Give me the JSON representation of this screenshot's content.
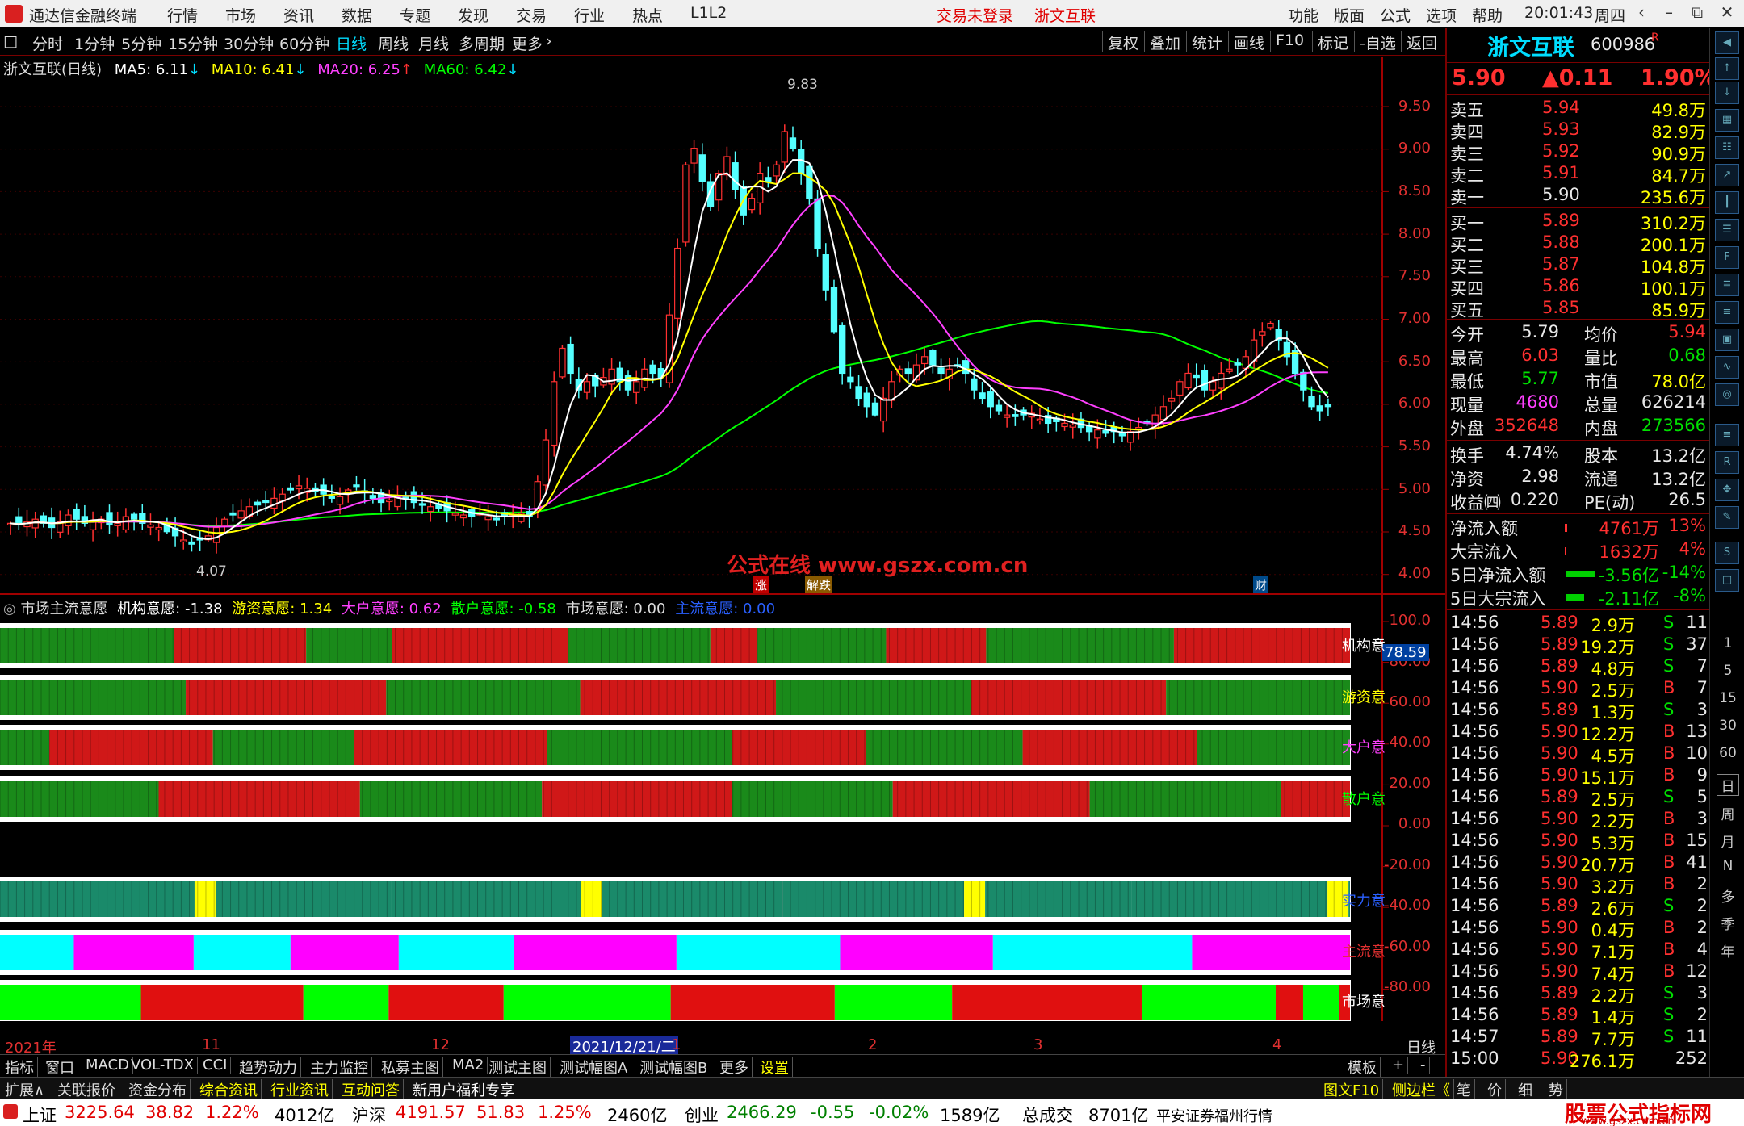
{
  "titlebar": {
    "app": "通达信金融终端",
    "menus": [
      "行情",
      "市场",
      "资讯",
      "数据",
      "专题",
      "发现",
      "交易",
      "行业",
      "热点",
      "L1L2"
    ],
    "login": "交易未登录",
    "stock": "浙文互联",
    "rmenus": [
      "功能",
      "版面",
      "公式",
      "选项",
      "帮助"
    ],
    "time": "20:01:43",
    "weekday": "周四"
  },
  "toolbar": {
    "periods": [
      "分时",
      "1分钟",
      "5分钟",
      "15分钟",
      "30分钟",
      "60分钟",
      "日线",
      "周线",
      "月线",
      "多周期",
      "更多"
    ],
    "active": "日线",
    "right": [
      "复权",
      "叠加",
      "统计",
      "画线",
      "F10",
      "标记",
      "-自选",
      "返回"
    ]
  },
  "legend": {
    "name": "浙文互联(日线)",
    "ma5": "MA5: 6.11",
    "ma10": "MA10: 6.41",
    "ma20": "MA20: 6.25",
    "ma60": "MA60: 6.42",
    "high": "9.83",
    "low": "4.07"
  },
  "price_axis": [
    "9.50",
    "9.00",
    "8.50",
    "8.00",
    "7.50",
    "7.00",
    "6.50",
    "6.00",
    "5.50",
    "5.00",
    "4.50",
    "4.00"
  ],
  "events": {
    "zhang": "涨",
    "jiedie": "解跌",
    "cai": "财"
  },
  "indicator": {
    "name": "市场主流意愿",
    "jg": "机构意愿: -1.38",
    "yz": "游资意愿: 1.34",
    "dh": "大户意愿: 0.62",
    "sh": "散户意愿: -0.58",
    "sc": "市场意愿: 0.00",
    "zl": "主流意愿: 0.00",
    "cur": "78.59",
    "labels": [
      "机构意",
      "游资意",
      "大户意",
      "散户意",
      "实力意",
      "主流意",
      "市场意"
    ]
  },
  "ind_axis": [
    "100.0",
    "80.00",
    "60.00",
    "40.00",
    "20.00",
    "0.00",
    "-20.00",
    "-40.00",
    "-60.00",
    "-80.00"
  ],
  "date_axis": {
    "y2021": "2021年",
    "m11": "11",
    "m12": "12",
    "cursor": "2021/12/21/二",
    "m1": "1",
    "m2": "2",
    "m3": "3",
    "m4": "4",
    "period": "日线"
  },
  "watermark": {
    "text": "公式在线  www.gszx.com.cn"
  },
  "quote": {
    "name": "浙文互联",
    "code": "600986",
    "flag": "R",
    "price": "5.90",
    "change": "▲0.11",
    "pct": "1.90%",
    "sells": [
      [
        "卖五",
        "5.94",
        "49.8万"
      ],
      [
        "卖四",
        "5.93",
        "82.9万"
      ],
      [
        "卖三",
        "5.92",
        "90.9万"
      ],
      [
        "卖二",
        "5.91",
        "84.7万"
      ],
      [
        "卖一",
        "5.90",
        "235.6万"
      ]
    ],
    "buys": [
      [
        "买一",
        "5.89",
        "310.2万"
      ],
      [
        "买二",
        "5.88",
        "200.1万"
      ],
      [
        "买三",
        "5.87",
        "104.8万"
      ],
      [
        "买四",
        "5.86",
        "100.1万"
      ],
      [
        "买五",
        "5.85",
        "85.9万"
      ]
    ],
    "stats": [
      [
        "今开",
        "5.79",
        "均价",
        "5.94"
      ],
      [
        "最高",
        "6.03",
        "量比",
        "0.68"
      ],
      [
        "最低",
        "5.77",
        "市值",
        "78.0亿"
      ],
      [
        "现量",
        "4680",
        "总量",
        "626214"
      ],
      [
        "外盘",
        "352648",
        "内盘",
        "273566"
      ]
    ],
    "fund": [
      [
        "换手",
        "4.74%",
        "股本",
        "13.2亿"
      ],
      [
        "净资",
        "2.98",
        "流通",
        "13.2亿"
      ],
      [
        "收益㈣",
        "0.220",
        "PE(动)",
        "26.5"
      ]
    ],
    "flow": [
      [
        "净流入额",
        "4761万",
        "13%"
      ],
      [
        "大宗流入",
        "1632万",
        "4%"
      ],
      [
        "5日净流入额",
        "-3.56亿",
        "-14%"
      ],
      [
        "5日大宗流入",
        "-2.11亿",
        "-8%"
      ]
    ],
    "ticks": [
      [
        "14:56",
        "5.89",
        "2.9万",
        "S",
        "11"
      ],
      [
        "14:56",
        "5.89",
        "19.2万",
        "S",
        "37"
      ],
      [
        "14:56",
        "5.89",
        "4.8万",
        "S",
        "7"
      ],
      [
        "14:56",
        "5.90",
        "2.5万",
        "B",
        "7"
      ],
      [
        "14:56",
        "5.89",
        "1.3万",
        "S",
        "3"
      ],
      [
        "14:56",
        "5.90",
        "12.2万",
        "B",
        "13"
      ],
      [
        "14:56",
        "5.90",
        "4.5万",
        "B",
        "10"
      ],
      [
        "14:56",
        "5.90",
        "15.1万",
        "B",
        "9"
      ],
      [
        "14:56",
        "5.89",
        "2.5万",
        "S",
        "5"
      ],
      [
        "14:56",
        "5.90",
        "2.2万",
        "B",
        "3"
      ],
      [
        "14:56",
        "5.90",
        "5.3万",
        "B",
        "15"
      ],
      [
        "14:56",
        "5.90",
        "20.7万",
        "B",
        "41"
      ],
      [
        "14:56",
        "5.90",
        "3.2万",
        "B",
        "2"
      ],
      [
        "14:56",
        "5.89",
        "2.6万",
        "S",
        "2"
      ],
      [
        "14:56",
        "5.90",
        "0.4万",
        "B",
        "2"
      ],
      [
        "14:56",
        "5.90",
        "7.1万",
        "B",
        "4"
      ],
      [
        "14:56",
        "5.90",
        "7.4万",
        "B",
        "12"
      ],
      [
        "14:56",
        "5.89",
        "2.2万",
        "S",
        "3"
      ],
      [
        "14:56",
        "5.89",
        "1.4万",
        "S",
        "2"
      ],
      [
        "14:57",
        "5.89",
        "7.7万",
        "S",
        "11"
      ],
      [
        "15:00",
        "5.90",
        "276.1万",
        "",
        "252"
      ]
    ]
  },
  "sidebar": {
    "periods": [
      "1",
      "5",
      "15",
      "30",
      "60",
      "日",
      "周",
      "月",
      "N",
      "多",
      "季",
      "年"
    ]
  },
  "tabs1": [
    "指标",
    "窗口",
    "MACD",
    "VOL-TDX",
    "CCI",
    "趋势动力",
    "主力监控",
    "私募主图",
    "MA2",
    "测试主图",
    "测试幅图A",
    "测试幅图B",
    "更多",
    "设置"
  ],
  "tabs1_right": [
    "模板",
    "+",
    "-"
  ],
  "tabs2": [
    "扩展∧",
    "关联报价",
    "资金分布",
    "综合资讯",
    "行业资讯",
    "互动问答",
    "新用户福利专享"
  ],
  "tabs2_right": [
    "图文F10",
    "侧边栏《",
    "笔",
    "价",
    "细",
    "势"
  ],
  "status": {
    "sh": "上证",
    "shv": "3225.64",
    "shc": "38.82",
    "shp": "1.22%",
    "sha": "4012亿",
    "hs": "沪深",
    "hsv": "4191.57",
    "hsc": "51.83",
    "hsp": "1.25%",
    "hsa": "2460亿",
    "cy": "创业",
    "cyv": "2466.29",
    "cyc": "-0.55",
    "cyp": "-0.02%",
    "cya": "1589亿",
    "tot": "总成交",
    "totv": "8701亿",
    "broker": "平安证券福州行情"
  },
  "site_logo": {
    "text": "股票公式指标网",
    "url": "www.gszx.com.cn"
  }
}
